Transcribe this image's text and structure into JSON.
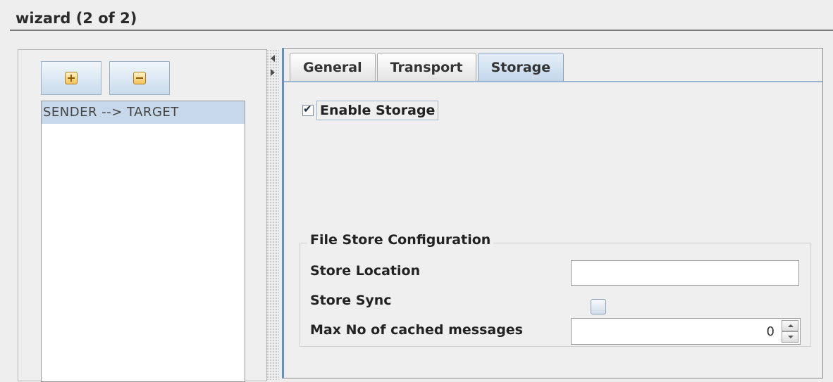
{
  "window": {
    "title": "wizard (2 of 2)"
  },
  "toolbar": {
    "add_icon": "plus-icon",
    "remove_icon": "minus-icon"
  },
  "routes": {
    "items": [
      {
        "label": "SENDER --> TARGET",
        "selected": true
      }
    ]
  },
  "splitter": {
    "collapse_left_icon": "arrow-left-icon",
    "collapse_right_icon": "arrow-right-icon"
  },
  "tabs": [
    {
      "label": "General",
      "active": false
    },
    {
      "label": "Transport",
      "active": false
    },
    {
      "label": "Storage",
      "active": true
    }
  ],
  "storage": {
    "enable_label": "Enable Storage",
    "enabled": true,
    "file_store": {
      "legend": "File Store Configuration",
      "store_location_label": "Store Location",
      "store_location_value": "",
      "store_sync_label": "Store Sync",
      "store_sync_checked": false,
      "max_cached_label": "Max No of cached messages",
      "max_cached_value": "0"
    }
  },
  "colors": {
    "accent": "#6a8fb5",
    "selection": "#c7d8ea",
    "background": "#eeeeee"
  }
}
